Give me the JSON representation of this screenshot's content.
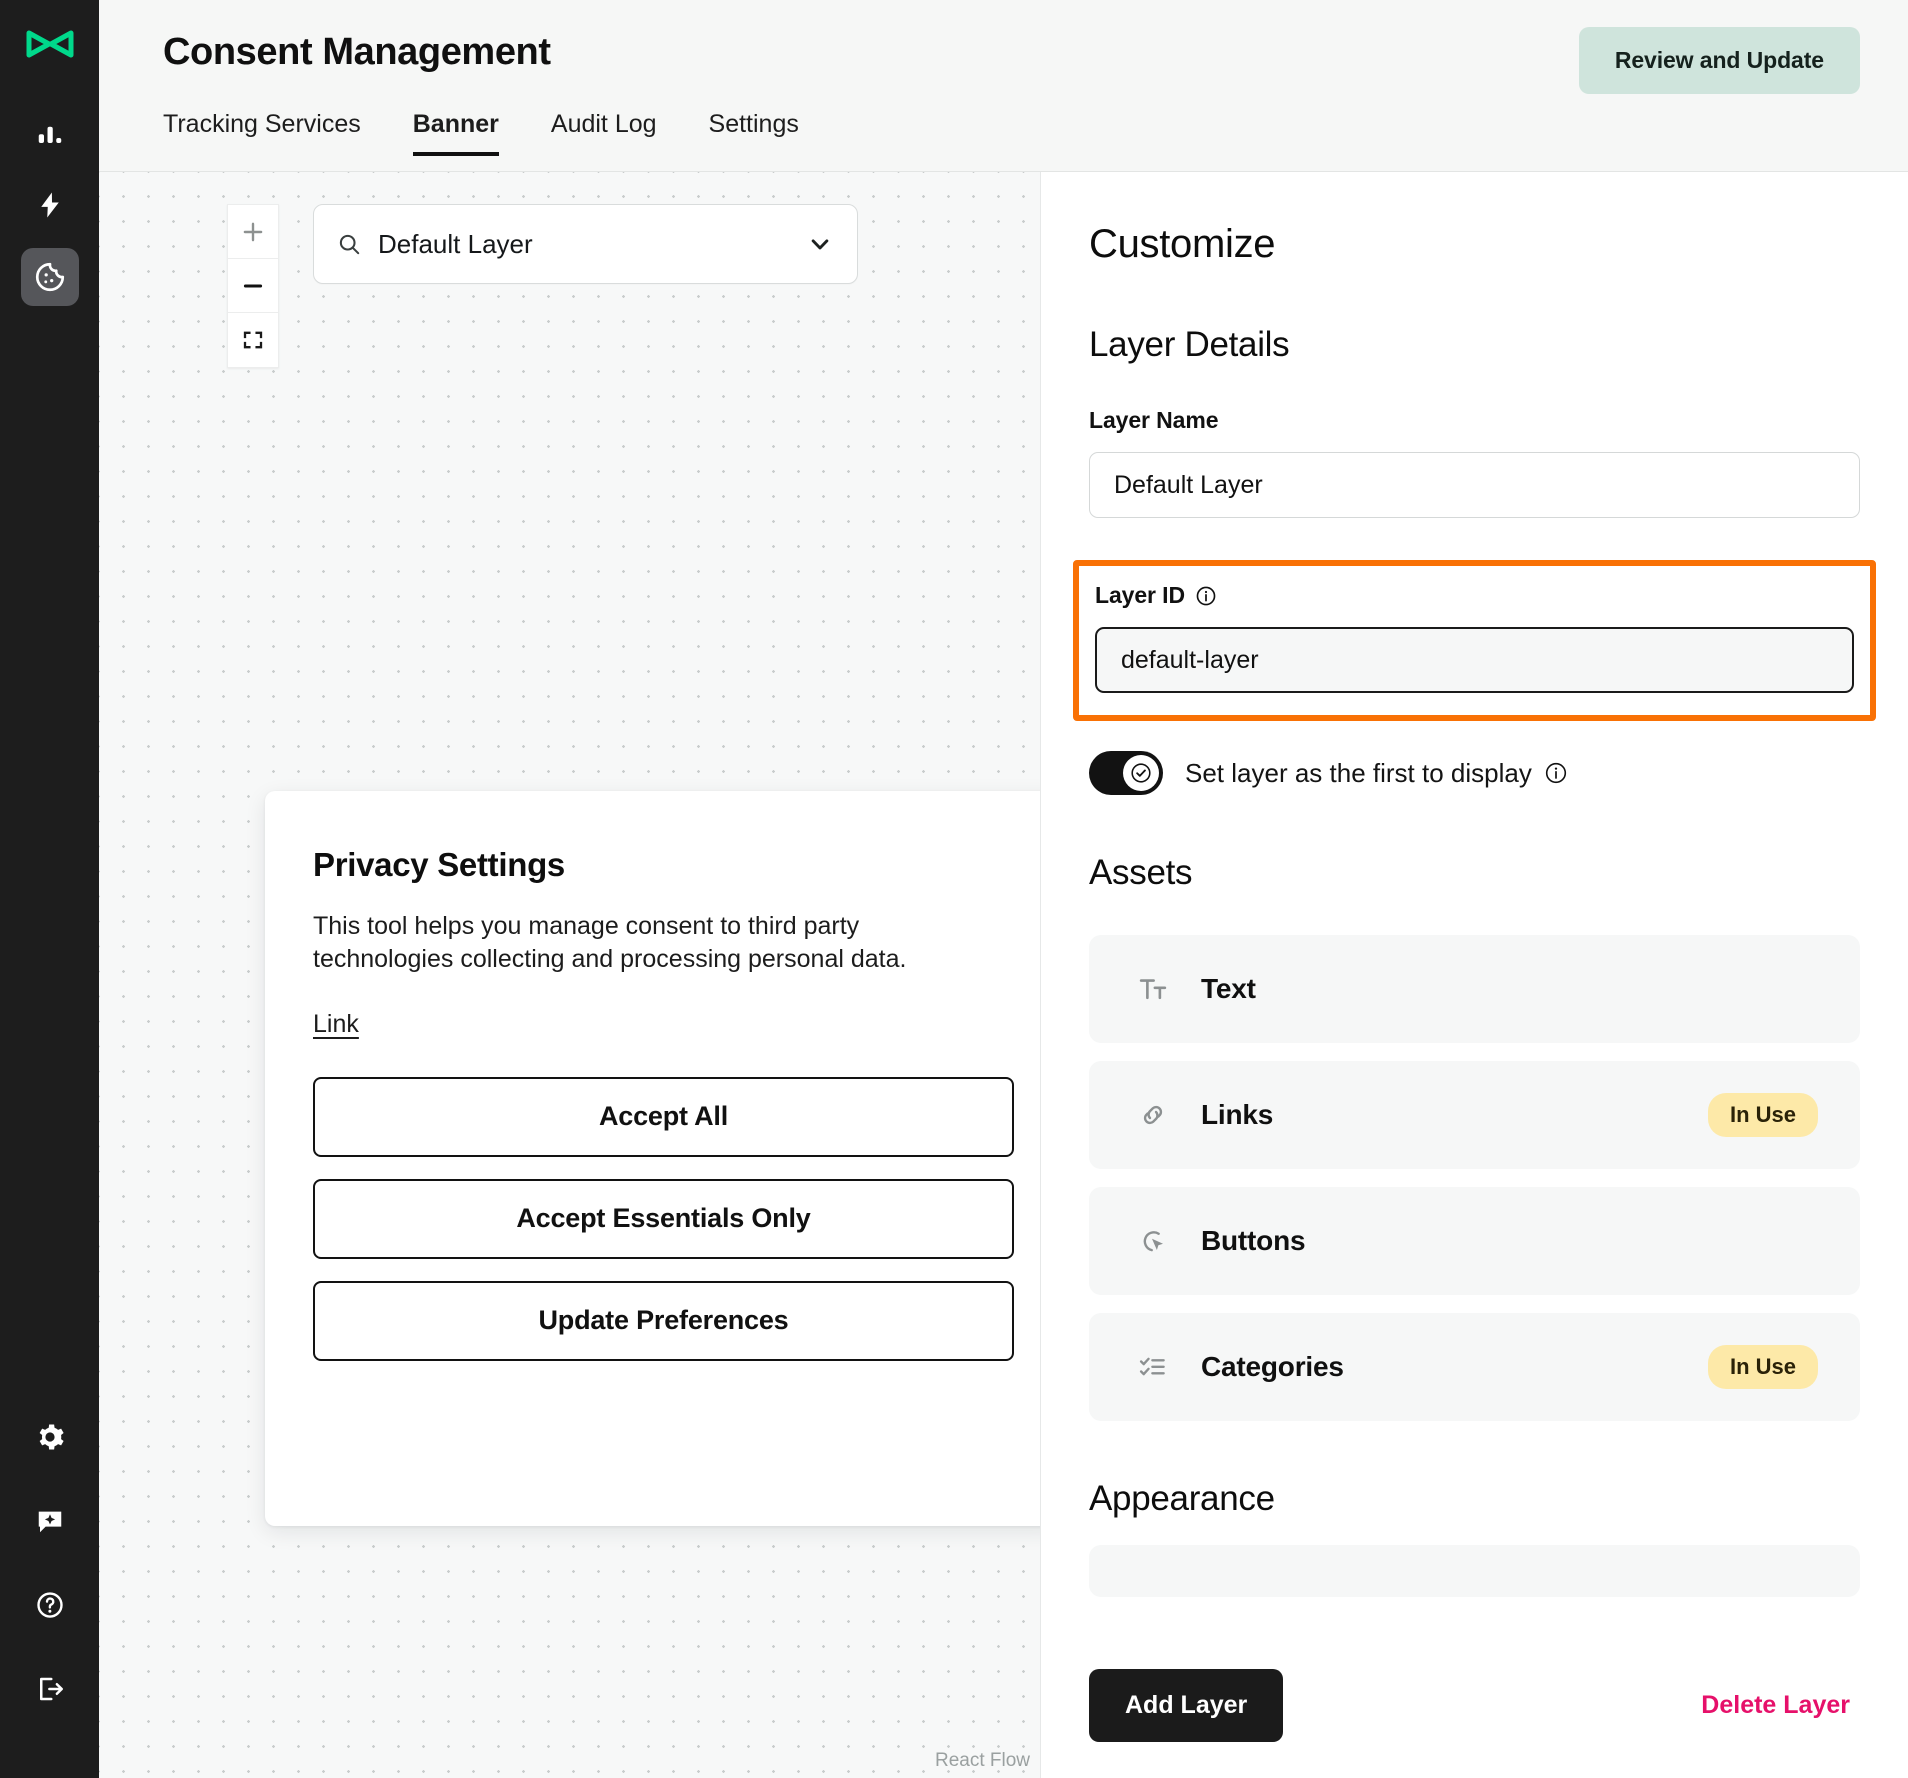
{
  "sidebar": {
    "logo_name": "brand-logo",
    "logo_color": "#00d98b",
    "items": [
      {
        "name": "analytics-icon",
        "label": "Analytics",
        "active": false
      },
      {
        "name": "automation-icon",
        "label": "Automation",
        "active": false
      },
      {
        "name": "cookie-consent-icon",
        "label": "Consent",
        "active": true
      }
    ],
    "bottom_items": [
      {
        "name": "gear-icon",
        "label": "Settings"
      },
      {
        "name": "ai-chat-icon",
        "label": "Assistant"
      },
      {
        "name": "help-circle-icon",
        "label": "Help"
      },
      {
        "name": "logout-icon",
        "label": "Log out"
      }
    ]
  },
  "header": {
    "title": "Consent Management",
    "review_button": "Review and Update",
    "review_button_bg": "#cfe4dc",
    "tabs": [
      {
        "label": "Tracking Services",
        "active": false
      },
      {
        "label": "Banner",
        "active": true
      },
      {
        "label": "Audit Log",
        "active": false
      },
      {
        "label": "Settings",
        "active": false
      }
    ]
  },
  "canvas": {
    "zoom_controls": [
      {
        "name": "zoom-in-button",
        "glyph": "+"
      },
      {
        "name": "zoom-out-button",
        "glyph": "−"
      },
      {
        "name": "fit-view-button",
        "glyph": "fit"
      }
    ],
    "layer_select": {
      "value": "Default Layer",
      "placeholder": "Default Layer",
      "search_icon": "search-icon",
      "chevron_icon": "chevron-down-icon"
    },
    "banner_preview": {
      "title": "Privacy Settings",
      "body": "This tool helps you manage consent to third party technologies collecting and processing personal data.",
      "link": "Link",
      "buttons": [
        "Accept All",
        "Accept Essentials Only",
        "Update Preferences"
      ]
    },
    "attribution": "React Flow"
  },
  "panel": {
    "heading": "Customize",
    "layer_details": {
      "heading": "Layer Details",
      "layer_name_label": "Layer Name",
      "layer_name_value": "Default Layer",
      "layer_name_placeholder": "Layer Name",
      "layer_id_label": "Layer ID",
      "layer_id_value": "default-layer",
      "layer_id_info_icon": "info-icon",
      "highlight_color": "#f97105",
      "toggle_label": "Set layer as the first to display",
      "toggle_state": "on",
      "toggle_info_icon": "info-icon"
    },
    "assets": {
      "heading": "Assets",
      "badge_color": "#fde9a8",
      "rows": [
        {
          "icon": "text-format-icon",
          "label": "Text",
          "badge": ""
        },
        {
          "icon": "link-icon",
          "label": "Links",
          "badge": "In Use"
        },
        {
          "icon": "cursor-click-icon",
          "label": "Buttons",
          "badge": ""
        },
        {
          "icon": "checklist-icon",
          "label": "Categories",
          "badge": "In Use"
        }
      ]
    },
    "appearance": {
      "heading": "Appearance"
    },
    "footer": {
      "add_layer": "Add Layer",
      "delete_layer": "Delete Layer",
      "delete_color": "#e6106a"
    }
  }
}
